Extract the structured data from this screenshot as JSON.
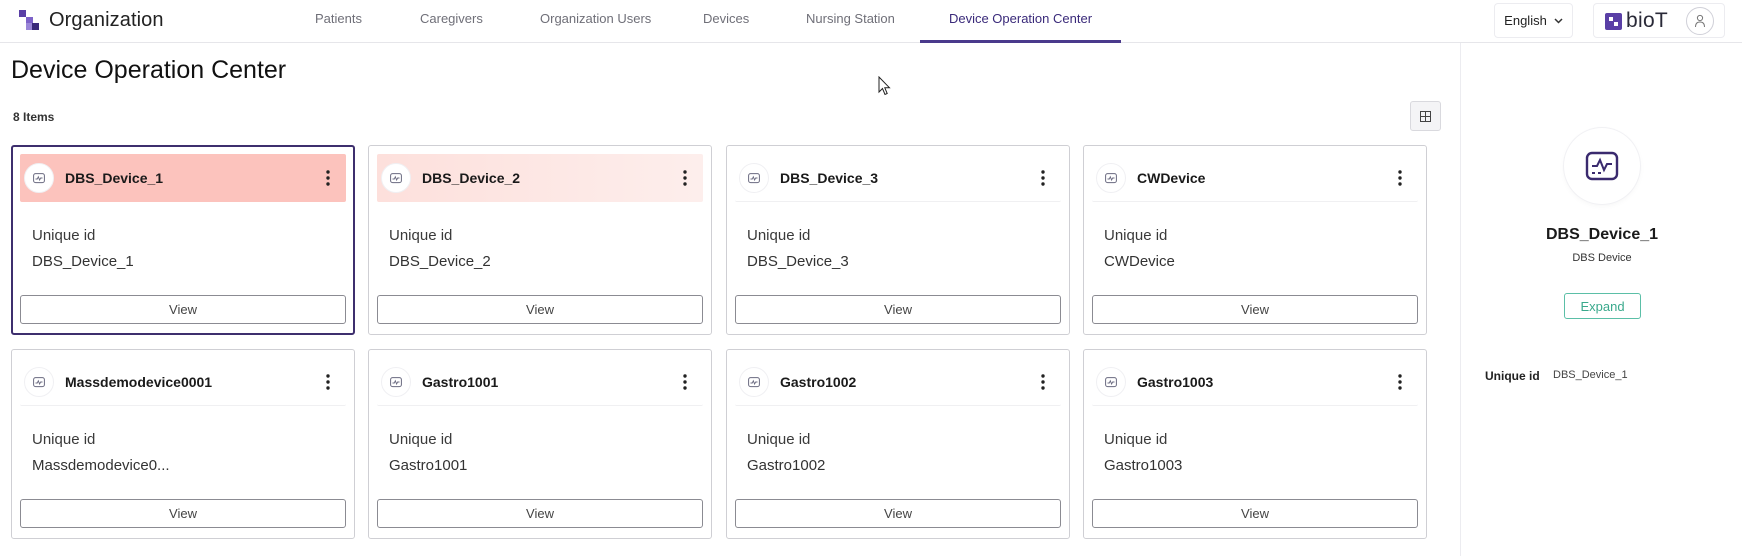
{
  "header": {
    "org_title": "Organization",
    "tabs": [
      {
        "label": "Patients"
      },
      {
        "label": "Caregivers"
      },
      {
        "label": "Organization Users"
      },
      {
        "label": "Devices"
      },
      {
        "label": "Nursing Station"
      },
      {
        "label": "Device Operation Center",
        "active": true
      }
    ],
    "language": "English",
    "logo_text": "bioT"
  },
  "main": {
    "page_title": "Device Operation Center",
    "item_count": "8 Items",
    "field_label": "Unique id",
    "view_label": "View",
    "devices": [
      {
        "name": "DBS_Device_1",
        "unique_id": "DBS_Device_1",
        "state": "selected"
      },
      {
        "name": "DBS_Device_2",
        "unique_id": "DBS_Device_2",
        "state": "highlighted"
      },
      {
        "name": "DBS_Device_3",
        "unique_id": "DBS_Device_3"
      },
      {
        "name": "CWDevice",
        "unique_id": "CWDevice"
      },
      {
        "name": "Massdemodevice0001",
        "unique_id": "Massdemodevice0..."
      },
      {
        "name": "Gastro1001",
        "unique_id": "Gastro1001"
      },
      {
        "name": "Gastro1002",
        "unique_id": "Gastro1002"
      },
      {
        "name": "Gastro1003",
        "unique_id": "Gastro1003"
      }
    ]
  },
  "detail": {
    "name": "DBS_Device_1",
    "type": "DBS Device",
    "expand_label": "Expand",
    "field_label": "Unique id",
    "field_value": "DBS_Device_1"
  },
  "colors": {
    "accent": "#4a3a8c",
    "selected_header": "#fcc3bd",
    "highlight_header": "#fde6e3",
    "expand_green": "#3aa98c"
  },
  "icons": {
    "brand": "organization-logo-icon",
    "device": "device-monitor-icon",
    "menu": "kebab-menu-icon",
    "grid": "grid-view-icon",
    "chevron": "chevron-down-icon",
    "user": "user-avatar-icon"
  }
}
